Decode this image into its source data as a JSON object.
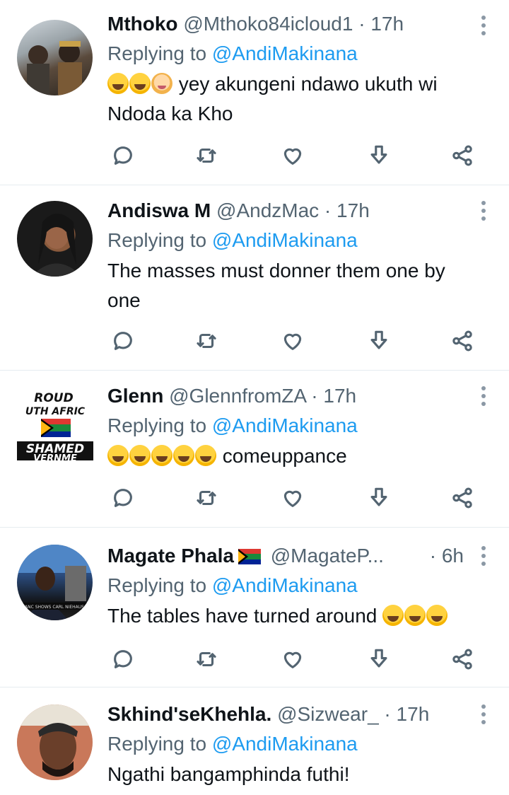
{
  "tweets": [
    {
      "name": "Mthoko",
      "handle": "@Mthoko84icloud1",
      "dot": " · ",
      "time": "17h",
      "replying_prefix": "Replying to ",
      "replying_to": "@AndiMakinana",
      "emojis": [
        "rofl",
        "joy",
        "person-shrugging"
      ],
      "text": "yey akungeni ndawo ukuth wi Ndoda ka Kho"
    },
    {
      "name": "Andiswa M",
      "handle": "@AndzMac",
      "dot": " · ",
      "time": "17h",
      "replying_prefix": "Replying to ",
      "replying_to": "@AndiMakinana",
      "emojis": [],
      "text": "The masses must donner them one by one"
    },
    {
      "name": "Glenn",
      "handle": "@GlennfromZA",
      "dot": " · ",
      "time": "17h",
      "replying_prefix": "Replying to ",
      "replying_to": "@AndiMakinana",
      "emojis": [
        "rofl",
        "rofl",
        "rofl",
        "rofl",
        "rofl"
      ],
      "text": "comeuppance",
      "avatar_text": [
        "ROUD",
        "UTH AFRIC",
        "SHAMED",
        "VERNME"
      ]
    },
    {
      "name": "Magate Phala",
      "handle": "@MagateP...",
      "dot": " · ",
      "time": "6h",
      "replying_prefix": "Replying to ",
      "replying_to": "@AndiMakinana",
      "emojis_after": [
        "rofl",
        "rofl",
        "rofl"
      ],
      "text": "The tables have turned around",
      "avatar_text": "ANC SHOWS CARL NIEHAUS"
    },
    {
      "name": "Skhind'seKhehla.",
      "handle": "@Sizwear_",
      "dot": " · ",
      "time": "17h",
      "replying_prefix": "Replying to ",
      "replying_to": "@AndiMakinana",
      "emojis": [],
      "text": "Ngathi bangamphinda futhi!"
    }
  ],
  "icons": {
    "reply": "comment-icon",
    "retweet": "retweet-icon",
    "like": "heart-icon",
    "save": "download-icon",
    "share": "share-icon",
    "more": "more-vertical-icon"
  },
  "colors": {
    "link": "#1d9bf0",
    "muted": "#536471",
    "text": "#0f1419",
    "divider": "#e6ecf0"
  }
}
